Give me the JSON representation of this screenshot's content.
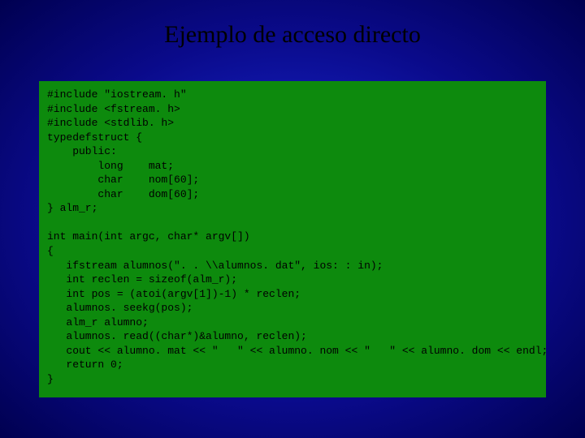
{
  "title": "Ejemplo de acceso directo",
  "code": "#include \"iostream. h\"\n#include <fstream. h>\n#include <stdlib. h>\ntypedefstruct {\n    public:\n        long    mat;\n        char    nom[60];\n        char    dom[60];\n} alm_r;\n\nint main(int argc, char* argv[])\n{\n   ifstream alumnos(\". . \\\\alumnos. dat\", ios: : in);\n   int reclen = sizeof(alm_r);\n   int pos = (atoi(argv[1])-1) * reclen;\n   alumnos. seekg(pos);\n   alm_r alumno;\n   alumnos. read((char*)&alumno, reclen);\n   cout << alumno. mat << \"   \" << alumno. nom << \"   \" << alumno. dom << endl;\n   return 0;\n}"
}
